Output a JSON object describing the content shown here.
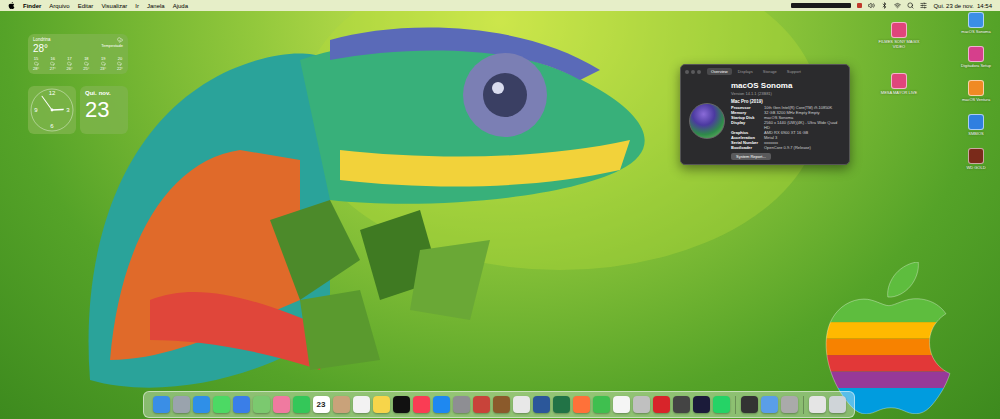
{
  "menu_bar": {
    "items": [
      {
        "label": "Finder",
        "bold": true
      },
      {
        "label": "Arquivo",
        "bold": false
      },
      {
        "label": "Editar",
        "bold": false
      },
      {
        "label": "Visualizar",
        "bold": false
      },
      {
        "label": "Ir",
        "bold": false
      },
      {
        "label": "Janela",
        "bold": false
      },
      {
        "label": "Ajuda",
        "bold": false
      }
    ],
    "clock": "Qui. 23 de nov.  14:54"
  },
  "weather": {
    "city": "Londrina",
    "temperature": "28°",
    "condition": "Tempestade",
    "hours": [
      {
        "time": "15",
        "temp": "28°"
      },
      {
        "time": "16",
        "temp": "27°"
      },
      {
        "time": "17",
        "temp": "26°"
      },
      {
        "time": "18",
        "temp": "25°"
      },
      {
        "time": "19",
        "temp": "23°"
      },
      {
        "time": "20",
        "temp": "22°"
      }
    ]
  },
  "clock_widget": {
    "numerals": [
      "12",
      "3",
      "6",
      "9"
    ],
    "hours": 14,
    "minutes": 54
  },
  "calendar_widget": {
    "weekday": "Qui.",
    "month": "nov.",
    "day": "23"
  },
  "about_window": {
    "tabs": [
      {
        "label": "Overview",
        "selected": true
      },
      {
        "label": "Displays",
        "selected": false
      },
      {
        "label": "Storage",
        "selected": false
      },
      {
        "label": "Support",
        "selected": false
      }
    ],
    "os_name": "macOS Sonoma",
    "version": "Version 14.1.1 (23B81)",
    "model": "Mac Pro (2019)",
    "specs": [
      {
        "label": "Processor",
        "value": "10th Gen Intel(R) Core(TM) i9-10850K"
      },
      {
        "label": "Memory",
        "value": "32 GB 3200 MHz Empty Empty"
      },
      {
        "label": "Startup Disk",
        "value": "macOS Sonoma"
      },
      {
        "label": "Display",
        "value": "2560 x 1440 (UW)(4K) - Ultra Wide Quad HD"
      },
      {
        "label": "Graphics",
        "value": "AMD RX 6900 XT 16 GB"
      },
      {
        "label": "Acceleration",
        "value": "Metal 3"
      },
      {
        "label": "Serial Number",
        "value": "xxxxxxx"
      },
      {
        "label": "Bootloader",
        "value": "OpenCore 0.9.7 (Release)"
      }
    ],
    "button": "System Report..."
  },
  "desktop_icons": {
    "left_column": [
      {
        "label": "FILMES SONY MAGIX VIDEO",
        "color": "#e0457b"
      },
      {
        "label": "MESA MAYOR LIVE",
        "color": "#e0457b"
      }
    ],
    "right_column": [
      {
        "label": "macOS Sonoma",
        "color": "#3a8ee6"
      },
      {
        "label": "Digitadora Setup",
        "color": "#d63f8c"
      },
      {
        "label": "macOS Ventura",
        "color": "#f08a24"
      },
      {
        "label": "SMBIOS",
        "color": "#2f7fe0"
      },
      {
        "label": "WD GOLD",
        "color": "#7a2a1a"
      }
    ]
  },
  "dock": [
    {
      "kind": "app",
      "color": "#3a8ee6",
      "text": ""
    },
    {
      "kind": "app",
      "color": "#9aa3ad",
      "text": ""
    },
    {
      "kind": "app",
      "color": "#2f8fe8",
      "text": ""
    },
    {
      "kind": "app",
      "color": "#4cd964",
      "text": ""
    },
    {
      "kind": "app",
      "color": "#3a7ee8",
      "text": ""
    },
    {
      "kind": "app",
      "color": "#7bc96f",
      "text": ""
    },
    {
      "kind": "app",
      "color": "#f07aa0",
      "text": ""
    },
    {
      "kind": "app",
      "color": "#34c759",
      "text": ""
    },
    {
      "kind": "app",
      "color": "#ffffff",
      "text": "23"
    },
    {
      "kind": "app",
      "color": "#c9a27a",
      "text": ""
    },
    {
      "kind": "app",
      "color": "#f2f2f2",
      "text": ""
    },
    {
      "kind": "app",
      "color": "#f7d54a",
      "text": ""
    },
    {
      "kind": "app",
      "color": "#111111",
      "text": ""
    },
    {
      "kind": "app",
      "color": "#fa3c54",
      "text": ""
    },
    {
      "kind": "app",
      "color": "#1e88f0",
      "text": ""
    },
    {
      "kind": "app",
      "color": "#8e8e93",
      "text": ""
    },
    {
      "kind": "app",
      "color": "#c8433a",
      "text": ""
    },
    {
      "kind": "app",
      "color": "#8b5a2b",
      "text": ""
    },
    {
      "kind": "app",
      "color": "#e8e8e8",
      "text": ""
    },
    {
      "kind": "app",
      "color": "#2b579a",
      "text": ""
    },
    {
      "kind": "app",
      "color": "#217346",
      "text": ""
    },
    {
      "kind": "app",
      "color": "#ff7139",
      "text": ""
    },
    {
      "kind": "app",
      "color": "#3fbf4f",
      "text": ""
    },
    {
      "kind": "app",
      "color": "#f5f5f5",
      "text": ""
    },
    {
      "kind": "app",
      "color": "#c0c0c0",
      "text": ""
    },
    {
      "kind": "app",
      "color": "#d8242a",
      "text": ""
    },
    {
      "kind": "app",
      "color": "#444444",
      "text": ""
    },
    {
      "kind": "app",
      "color": "#1b1b3a",
      "text": ""
    },
    {
      "kind": "app",
      "color": "#25d366",
      "text": ""
    },
    {
      "kind": "separator",
      "color": "#000000",
      "text": ""
    },
    {
      "kind": "app",
      "color": "#333333",
      "text": ""
    },
    {
      "kind": "app",
      "color": "#5a9ee8",
      "text": ""
    },
    {
      "kind": "app",
      "color": "#aaaaaa",
      "text": ""
    },
    {
      "kind": "separator",
      "color": "#000000",
      "text": ""
    },
    {
      "kind": "app",
      "color": "#e5e5e5",
      "text": ""
    },
    {
      "kind": "app",
      "color": "#cfd4d8",
      "text": ""
    }
  ]
}
